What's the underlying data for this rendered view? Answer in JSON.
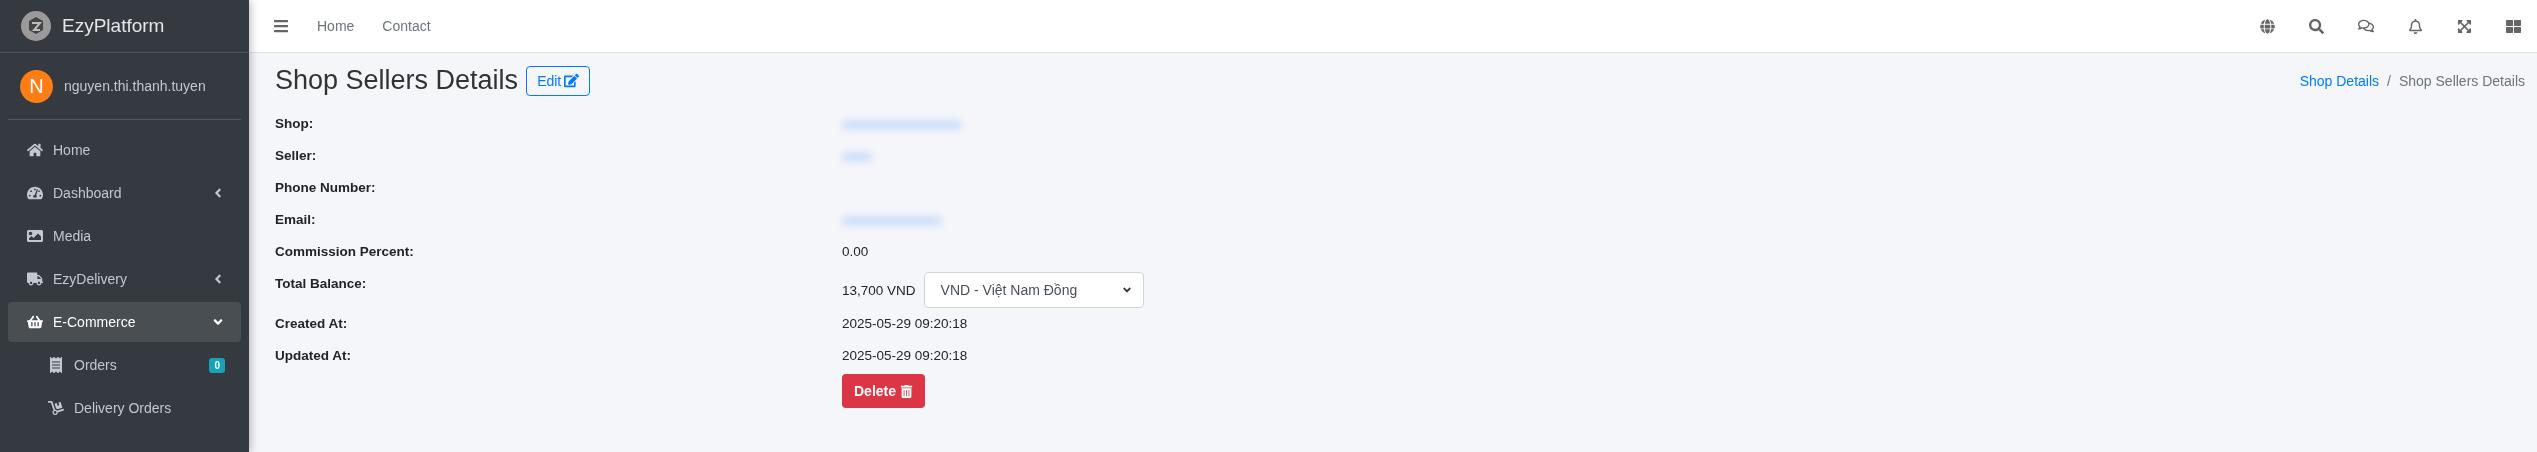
{
  "brand": {
    "name": "EzyPlatform"
  },
  "user": {
    "initial": "N",
    "name": "nguyen.thi.thanh.tuyen"
  },
  "sidebar": {
    "items": [
      {
        "label": "Home",
        "selected": false
      },
      {
        "label": "Dashboard",
        "selected": false,
        "expanded": false
      },
      {
        "label": "Media",
        "selected": false
      },
      {
        "label": "EzyDelivery",
        "selected": false,
        "expanded": false
      },
      {
        "label": "E-Commerce",
        "selected": true,
        "expanded": true,
        "children": [
          {
            "label": "Orders",
            "badge": "0",
            "selected": false
          },
          {
            "label": "Delivery Orders",
            "selected": false
          }
        ]
      }
    ]
  },
  "topnav": {
    "links": [
      "Home",
      "Contact"
    ]
  },
  "page": {
    "title": "Shop Sellers Details",
    "edit_button": "Edit"
  },
  "breadcrumb_separator": "/",
  "breadcrumb": [
    {
      "label": "Shop Details",
      "kind": "link"
    },
    {
      "label": "Shop Sellers Details",
      "kind": "current"
    }
  ],
  "details": [
    {
      "label": "Shop:",
      "kind": "redacted"
    },
    {
      "label": "Seller:",
      "kind": "redacted"
    },
    {
      "label": "Phone Number:",
      "kind": "none"
    },
    {
      "label": "Email:",
      "kind": "redacted"
    },
    {
      "label": "Commission Percent:",
      "kind": "text",
      "value": "0.00"
    },
    {
      "label": "Total Balance:",
      "kind": "balance",
      "value": "13,700 VND",
      "currency": "VND - Việt Nam Đồng"
    },
    {
      "label": "Created At:",
      "kind": "text",
      "value": "2025-05-29 09:20:18"
    },
    {
      "label": "Updated At:",
      "kind": "text",
      "value": "2025-05-29 09:20:18"
    }
  ],
  "delete_button": "Delete"
}
